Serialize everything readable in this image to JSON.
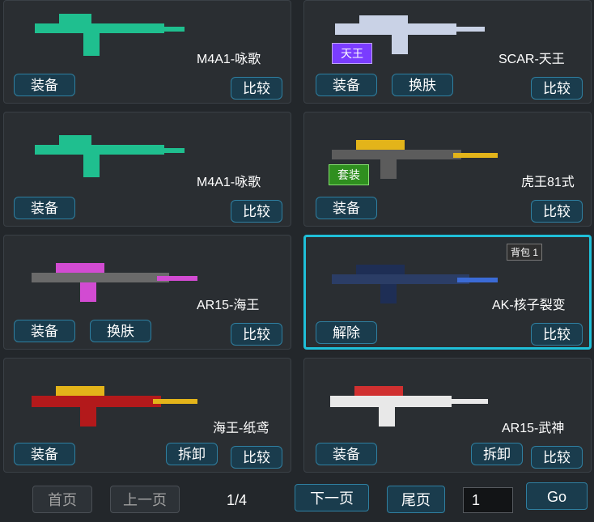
{
  "slots": [
    {
      "name": "M4A1-咏歌",
      "buttons": {
        "equip": "装备",
        "compare": "比较"
      }
    },
    {
      "name": "SCAR-天王",
      "buttons": {
        "equip": "装备",
        "skin": "换肤",
        "compare": "比较"
      },
      "badge": "天王"
    },
    {
      "name": "M4A1-咏歌",
      "buttons": {
        "equip": "装备",
        "compare": "比较"
      }
    },
    {
      "name": "虎王81式",
      "buttons": {
        "equip": "装备",
        "compare": "比较"
      },
      "badge": "套装"
    },
    {
      "name": "AR15-海王",
      "buttons": {
        "equip": "装备",
        "skin": "换肤",
        "compare": "比较"
      }
    },
    {
      "name": "AK-核子裂变",
      "buttons": {
        "unequip": "解除",
        "compare": "比较"
      },
      "tag": "背包 1"
    },
    {
      "name": "海王-纸鸢",
      "buttons": {
        "equip": "装备",
        "uninstall": "拆卸",
        "compare": "比较"
      }
    },
    {
      "name": "AR15-武神",
      "buttons": {
        "equip": "装备",
        "uninstall": "拆卸",
        "compare": "比较"
      }
    }
  ],
  "pagination": {
    "first": "首页",
    "prev": "上一页",
    "page": "1/4",
    "next": "下一页",
    "last": "尾页",
    "input": "1",
    "go": "Go"
  }
}
